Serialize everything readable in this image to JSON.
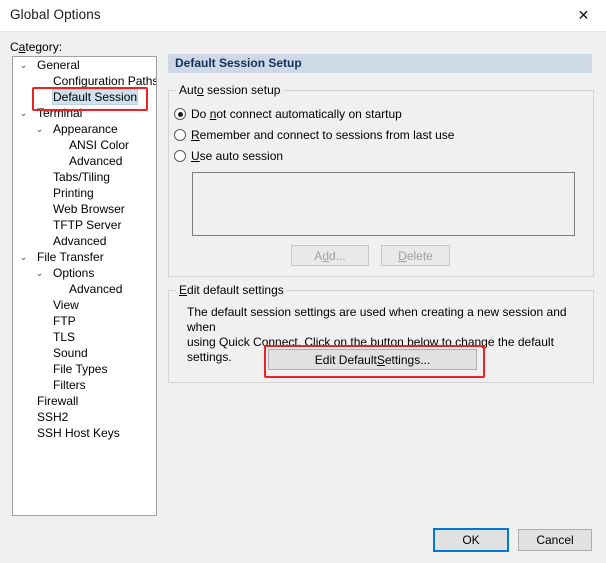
{
  "window": {
    "title": "Global Options",
    "close_icon": "close-icon",
    "close_glyph": "✕"
  },
  "category": {
    "label_pre": "C",
    "label_mnemonic": "a",
    "label_post": "tegory:"
  },
  "tree": {
    "items": [
      {
        "label": "General",
        "depth": 0,
        "expander": "⌄",
        "expanded": true,
        "selected": false
      },
      {
        "label": "Configuration Paths",
        "depth": 1,
        "expander": "",
        "expanded": false,
        "selected": false
      },
      {
        "label": "Default Session",
        "depth": 1,
        "expander": "",
        "expanded": false,
        "selected": true
      },
      {
        "label": "Terminal",
        "depth": 0,
        "expander": "⌄",
        "expanded": true,
        "selected": false
      },
      {
        "label": "Appearance",
        "depth": 1,
        "expander": "⌄",
        "expanded": true,
        "selected": false
      },
      {
        "label": "ANSI Color",
        "depth": 2,
        "expander": "",
        "expanded": false,
        "selected": false
      },
      {
        "label": "Advanced",
        "depth": 2,
        "expander": "",
        "expanded": false,
        "selected": false
      },
      {
        "label": "Tabs/Tiling",
        "depth": 1,
        "expander": "",
        "expanded": false,
        "selected": false
      },
      {
        "label": "Printing",
        "depth": 1,
        "expander": "",
        "expanded": false,
        "selected": false
      },
      {
        "label": "Web Browser",
        "depth": 1,
        "expander": "",
        "expanded": false,
        "selected": false
      },
      {
        "label": "TFTP Server",
        "depth": 1,
        "expander": "",
        "expanded": false,
        "selected": false
      },
      {
        "label": "Advanced",
        "depth": 1,
        "expander": "",
        "expanded": false,
        "selected": false
      },
      {
        "label": "File Transfer",
        "depth": 0,
        "expander": "⌄",
        "expanded": true,
        "selected": false
      },
      {
        "label": "Options",
        "depth": 1,
        "expander": "⌄",
        "expanded": true,
        "selected": false
      },
      {
        "label": "Advanced",
        "depth": 2,
        "expander": "",
        "expanded": false,
        "selected": false
      },
      {
        "label": "View",
        "depth": 1,
        "expander": "",
        "expanded": false,
        "selected": false
      },
      {
        "label": "FTP",
        "depth": 1,
        "expander": "",
        "expanded": false,
        "selected": false
      },
      {
        "label": "TLS",
        "depth": 1,
        "expander": "",
        "expanded": false,
        "selected": false
      },
      {
        "label": "Sound",
        "depth": 1,
        "expander": "",
        "expanded": false,
        "selected": false
      },
      {
        "label": "File Types",
        "depth": 1,
        "expander": "",
        "expanded": false,
        "selected": false
      },
      {
        "label": "Filters",
        "depth": 1,
        "expander": "",
        "expanded": false,
        "selected": false
      },
      {
        "label": "Firewall",
        "depth": 0,
        "expander": "",
        "expanded": false,
        "selected": false
      },
      {
        "label": "SSH2",
        "depth": 0,
        "expander": "",
        "expanded": false,
        "selected": false
      },
      {
        "label": "SSH Host Keys",
        "depth": 0,
        "expander": "",
        "expanded": false,
        "selected": false
      }
    ]
  },
  "content": {
    "section_header": "Default Session Setup",
    "auto_group": {
      "title_pre": "Aut",
      "title_mnemonic": "o",
      "title_post": " session setup",
      "radios": [
        {
          "pre": "Do ",
          "mnemonic": "n",
          "post": "ot connect automatically on startup",
          "checked": true
        },
        {
          "pre": "",
          "mnemonic": "R",
          "post": "emember and connect to sessions from last use",
          "checked": false
        },
        {
          "pre": "",
          "mnemonic": "U",
          "post": "se auto session",
          "checked": false
        }
      ],
      "listbox_items": [],
      "add_button": {
        "pre": "A",
        "mnemonic": "d",
        "post": "d...",
        "enabled": false
      },
      "delete_button": {
        "pre": "",
        "mnemonic": "D",
        "post": "elete",
        "enabled": false
      }
    },
    "edit_group": {
      "title_pre": "",
      "title_mnemonic": "E",
      "title_post": "dit default settings",
      "description_line1": "The default session settings are used when creating a new session and when",
      "description_line2": "using Quick Connect.  Click on the button below to change the default settings.",
      "button": {
        "pre": "Edit Default ",
        "mnemonic": "S",
        "post": "ettings..."
      }
    }
  },
  "footer": {
    "ok_label": "OK",
    "cancel_label": "Cancel"
  },
  "annotations": {
    "color": "#ee2222",
    "targets": [
      "tree-item-default-session",
      "edit-default-settings-button"
    ]
  }
}
